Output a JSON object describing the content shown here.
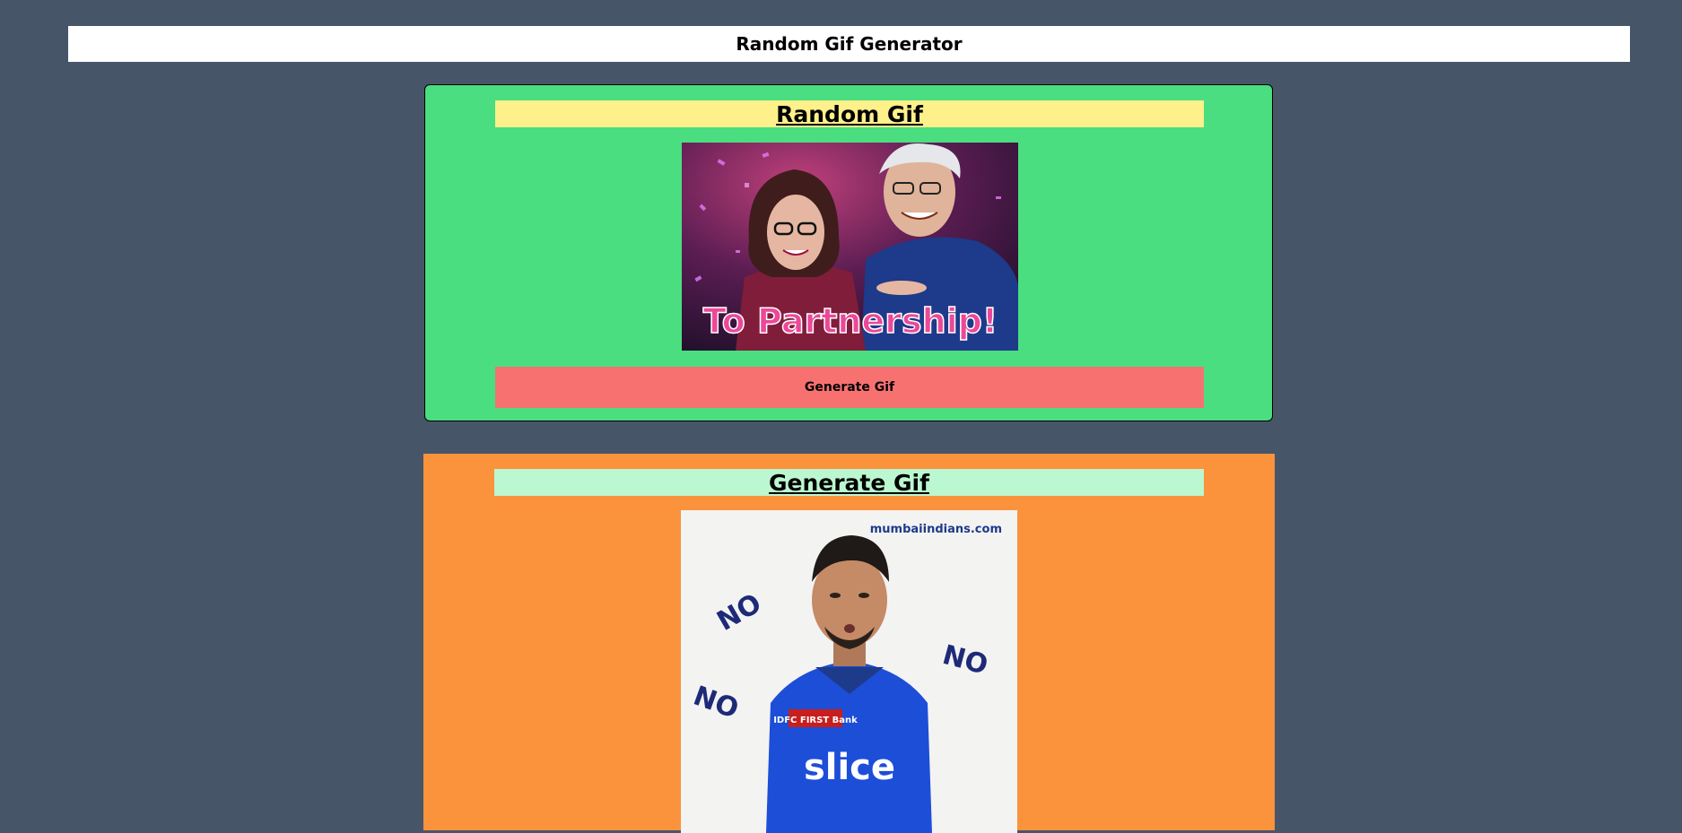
{
  "header": {
    "title": "Random Gif Generator"
  },
  "random_card": {
    "title": "Random Gif",
    "gif_caption": "To Partnership!",
    "button_label": "Generate Gif"
  },
  "generate_card": {
    "title": "Generate Gif",
    "gif_watermark": "mumbaiindians.com",
    "gif_words": [
      "NO",
      "NO",
      "NO"
    ],
    "jersey_text": "slice",
    "jersey_sponsor": "IDFC FIRST Bank"
  },
  "colors": {
    "page_bg": "#475569",
    "header_bg": "#ffffff",
    "random_card_bg": "#4ade80",
    "random_title_bg": "#fef08a",
    "button_bg": "#f87171",
    "generate_card_bg": "#fb923c",
    "generate_title_bg": "#bbf7d0"
  }
}
